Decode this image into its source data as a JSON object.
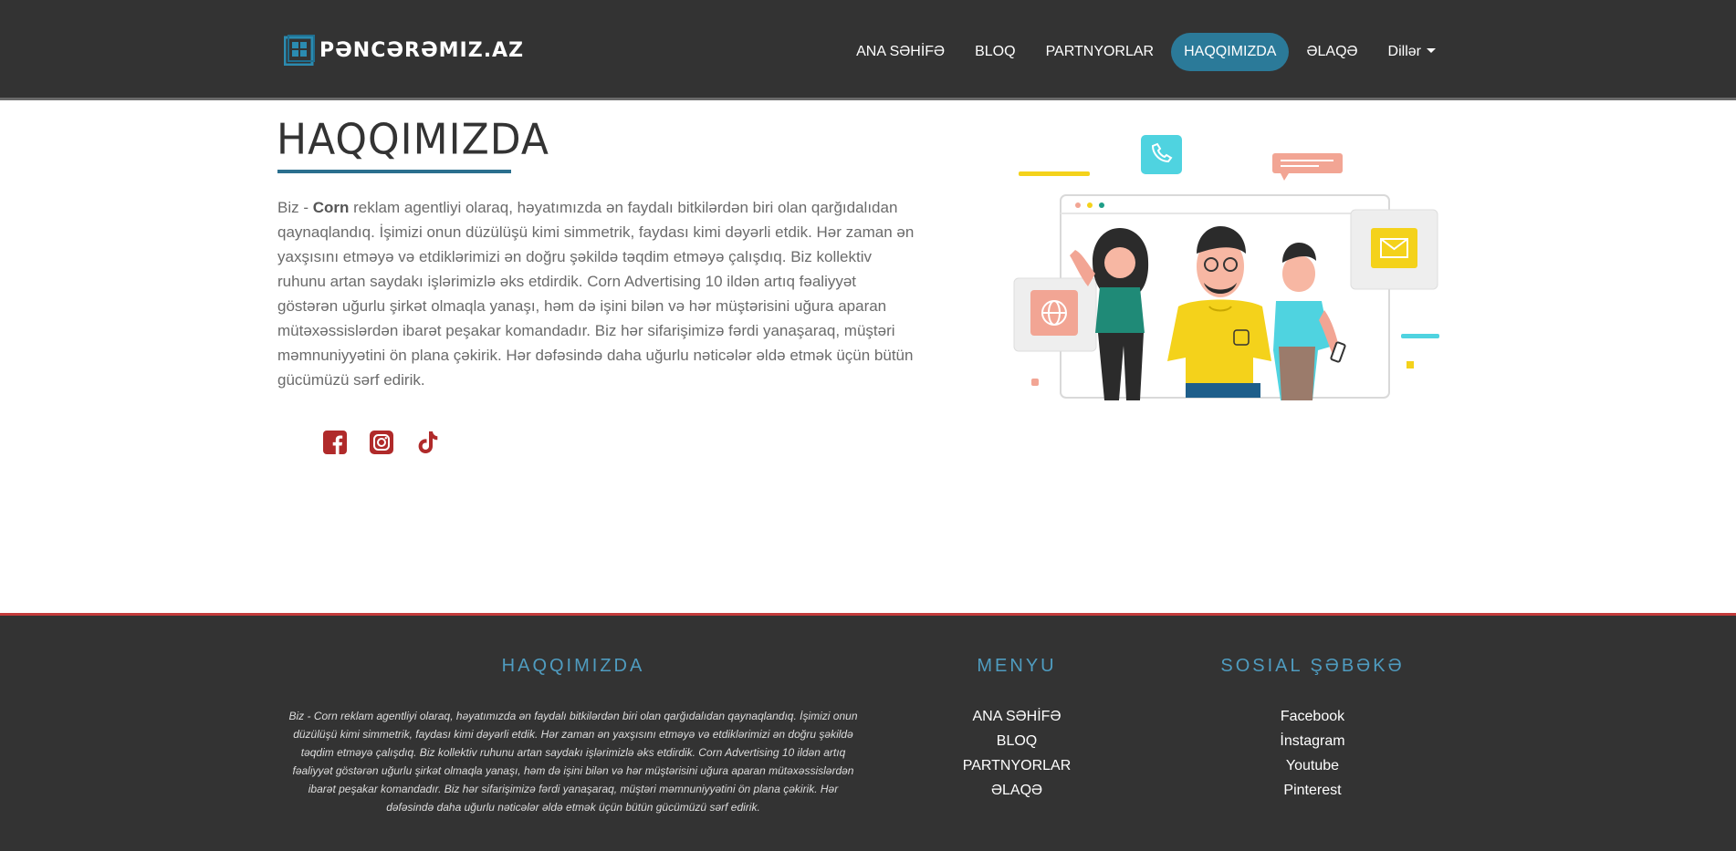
{
  "header": {
    "logo_text": "PƏNCƏRƏMIZ.AZ",
    "nav": [
      {
        "label": "ANA SƏHİFƏ",
        "active": false
      },
      {
        "label": "BLOQ",
        "active": false
      },
      {
        "label": "PARTNYORLAR",
        "active": false
      },
      {
        "label": "HAQQIMIZDA",
        "active": true
      },
      {
        "label": "ƏLAQƏ",
        "active": false
      }
    ],
    "lang_dropdown": "Dillər"
  },
  "main": {
    "title": "HAQQIMIZDA",
    "text_lead": "Biz - ",
    "text_brand": "Corn",
    "text_body": " reklam agentliyi olaraq, həyatımızda ən faydalı bitkilərdən biri olan qarğıdalıdan qaynaqlandıq. İşimizi onun düzülüşü kimi simmetrik, faydası kimi dəyərli etdik. Hər zaman ən yaxşısını etməyə və etdiklərimizi ən doğru şəkildə təqdim etməyə çalışdıq. Biz kollektiv ruhunu artan saydakı işlərimizlə əks etdirdik. Corn Advertising 10 ildən artıq fəaliyyət göstərən uğurlu şirkət olmaqla yanaşı, həm də işini bilən və hər müştərisini uğura aparan mütəxəssislərdən ibarət peşakar komandadır. Biz hər sifarişimizə fərdi yanaşaraq, müştəri məmnuniyyətini ön plana çəkirik. Hər dəfəsində daha uğurlu nəticələr əldə etmək üçün bütün gücümüzü sərf edirik.",
    "social_icons": [
      "facebook-icon",
      "instagram-icon",
      "tiktok-icon"
    ]
  },
  "footer": {
    "about_heading": "HAQQIMIZDA",
    "about_text": "Biz - Corn reklam agentliyi olaraq, həyatımızda ən faydalı bitkilərdən biri olan qarğıdalıdan qaynaqlandıq. İşimizi onun düzülüşü kimi simmetrik, faydası kimi dəyərli etdik. Hər zaman ən yaxşısını etməyə və etdiklərimizi ən doğru şəkildə təqdim etməyə çalışdıq. Biz kollektiv ruhunu artan saydakı işlərimizlə əks etdirdik. Corn Advertising 10 ildən artıq fəaliyyət göstərən uğurlu şirkət olmaqla yanaşı, həm də işini bilən və hər müştərisini uğura aparan mütəxəssislərdən ibarət peşakar komandadır. Biz hər sifarişimizə fərdi yanaşaraq, müştəri məmnuniyyətini ön plana çəkirik. Hər dəfəsində daha uğurlu nəticələr əldə etmək üçün bütün gücümüzü sərf edirik.",
    "menu_heading": "MENYU",
    "menu": [
      "ANA SƏHİFƏ",
      "BLOQ",
      "PARTNYORLAR",
      "ƏLAQƏ"
    ],
    "social_heading": "SOSIAL ŞƏBƏKƏ",
    "social": [
      "Facebook",
      "İnstagram",
      "Youtube",
      "Pinterest"
    ]
  },
  "colors": {
    "header_bg": "#333333",
    "accent_blue": "#2b7a99",
    "footer_heading": "#4f9cc0",
    "social_icon_red": "#b02a2a",
    "footer_border_red": "#c43b3b"
  }
}
